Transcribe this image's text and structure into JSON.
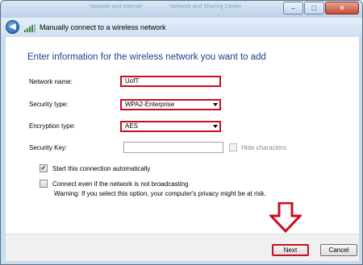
{
  "breadcrumb_ghost": [
    "Network and Internet",
    "Network and Sharing Center"
  ],
  "window": {
    "title": "Manually connect to a wireless network",
    "minimize_glyph": "–",
    "maximize_glyph": "□",
    "close_glyph": "✕",
    "back_glyph": "◀"
  },
  "form": {
    "heading": "Enter information for the wireless network you want to add",
    "network_name_label": "Network name:",
    "network_name_value": "UofT",
    "security_type_label": "Security type:",
    "security_type_value": "WPA2-Enterprise",
    "encryption_type_label": "Encryption type:",
    "encryption_type_value": "AES",
    "security_key_label": "Security Key:",
    "security_key_value": "",
    "hide_characters_label": "Hide characters",
    "hide_characters_checked": false,
    "start_auto_label": "Start this connection automatically",
    "start_auto_checked": true,
    "start_auto_mark": "✔",
    "connect_hidden_label": "Connect even if the network is not broadcasting",
    "connect_hidden_checked": false,
    "warning_text": "Warning: If you select this option, your computer's privacy might be at risk."
  },
  "buttons": {
    "next_label": "Next",
    "cancel_label": "Cancel"
  },
  "colors": {
    "highlight": "#cc0d1f",
    "heading": "#1e3f8c",
    "frame": "#c9dced"
  },
  "icons": [
    "back-arrow-icon",
    "wireless-signal-icon",
    "minimize-icon",
    "maximize-icon",
    "close-icon",
    "select-arrow-icon",
    "checkmark-icon",
    "down-arrow-icon"
  ]
}
